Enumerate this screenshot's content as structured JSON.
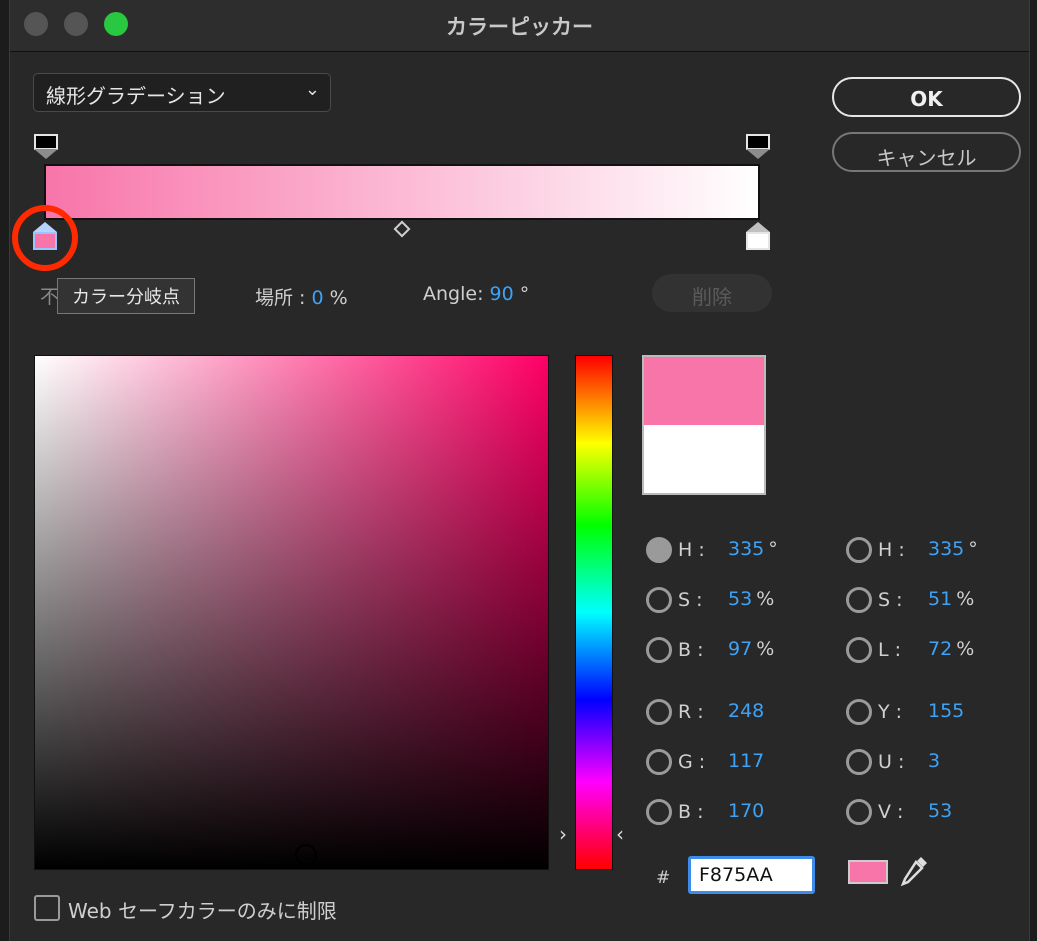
{
  "window": {
    "title": "カラーピッカー"
  },
  "gradient_type": {
    "selected": "線形グラデーション"
  },
  "buttons": {
    "ok": "OK",
    "cancel": "キャンセル",
    "delete": "削除"
  },
  "gradient": {
    "start_color": "#F875AA",
    "end_color": "#FFFFFF",
    "opacity_start_color": "#000000",
    "opacity_end_color": "#000000"
  },
  "tooltip": "カラー分岐点",
  "stop": {
    "hidden_label": "不",
    "location_label": "場所 :",
    "location_value": "0",
    "location_unit": "%",
    "angle_label": "Angle:",
    "angle_value": "90",
    "angle_unit": "°"
  },
  "icons": {
    "chevron": "chevron-down-icon",
    "eyedropper": "eyedropper-icon",
    "hue_left": "chevron-right-icon",
    "hue_right": "chevron-left-icon"
  },
  "picker": {
    "new_color": "#F875AA",
    "old_color": "#FFFFFF",
    "hue_arrow_left": "›",
    "hue_arrow_right": "‹"
  },
  "hsb": [
    {
      "label": "H :",
      "value": "335",
      "unit": "°",
      "selected": true
    },
    {
      "label": "S :",
      "value": "53",
      "unit": "%",
      "selected": false
    },
    {
      "label": "B :",
      "value": "97",
      "unit": "%",
      "selected": false
    }
  ],
  "hsl": [
    {
      "label": "H :",
      "value": "335",
      "unit": "°",
      "selected": false
    },
    {
      "label": "S :",
      "value": "51",
      "unit": "%",
      "selected": false
    },
    {
      "label": "L :",
      "value": "72",
      "unit": "%",
      "selected": false
    }
  ],
  "rgb": [
    {
      "label": "R :",
      "value": "248",
      "unit": ""
    },
    {
      "label": "G :",
      "value": "117",
      "unit": ""
    },
    {
      "label": "B :",
      "value": "170",
      "unit": ""
    }
  ],
  "yuv": [
    {
      "label": "Y :",
      "value": "155",
      "unit": ""
    },
    {
      "label": "U :",
      "value": "3",
      "unit": ""
    },
    {
      "label": "V :",
      "value": "53",
      "unit": ""
    }
  ],
  "hex": {
    "hash": "#",
    "value": "F875AA"
  },
  "websafe": {
    "label": "Web セーフカラーのみに制限",
    "checked": false
  }
}
